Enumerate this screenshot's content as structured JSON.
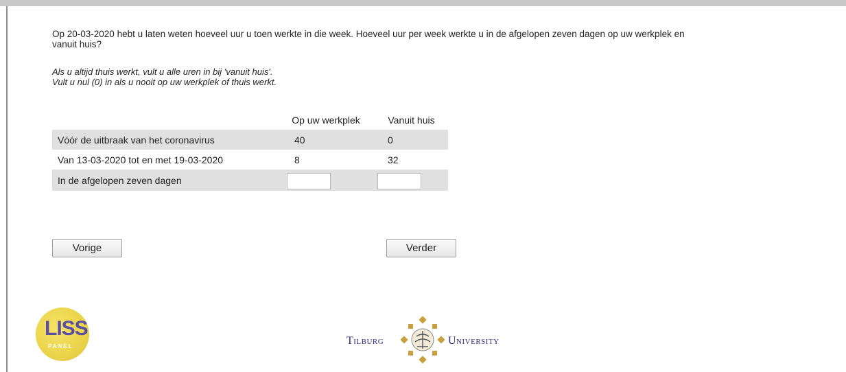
{
  "question": "Op 20-03-2020 hebt u laten weten hoeveel uur u toen werkte in die week. Hoeveel uur per week werkte u in de afgelopen zeven dagen op uw werkplek en vanuit huis?",
  "instructions": [
    "Als u altijd thuis werkt, vult u alle uren in bij 'vanuit huis'.",
    "Vult u nul (0) in als u nooit op uw werkplek of thuis werkt."
  ],
  "table": {
    "headers": [
      "",
      "Op uw werkplek",
      "Vanuit huis"
    ],
    "rows": [
      {
        "label": "Vóór de uitbraak van het coronavirus",
        "werkplek": "40",
        "huis": "0"
      },
      {
        "label": "Van 13-03-2020 tot en met 19-03-2020",
        "werkplek": "8",
        "huis": "32"
      },
      {
        "label": "In de afgelopen zeven dagen",
        "werkplek_value": "",
        "huis_value": ""
      }
    ]
  },
  "buttons": {
    "prev": "Vorige",
    "next": "Verder"
  },
  "logos": {
    "liss_main": "LISS",
    "liss_sub": "PANEL",
    "tilburg_left": "Tilburg",
    "tilburg_right": "University"
  },
  "colors": {
    "row_shade": "#e0e0e0",
    "liss_yellow": "#ead449",
    "tilburg_blue": "#2c2f7a",
    "tilburg_gold": "#c9a040"
  }
}
